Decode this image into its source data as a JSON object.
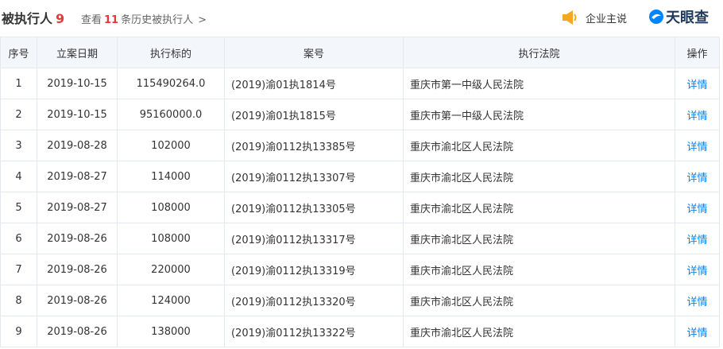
{
  "header": {
    "title": "被执行人",
    "count": "9",
    "history_prefix": "查看",
    "history_count": "11",
    "history_suffix": "条历史被执行人",
    "history_arrow": ">",
    "owner_label": "企业主说",
    "owner_icon": "speaker-icon",
    "brand": "天眼查",
    "brand_icon": "tianyancha-logo-icon",
    "accent_color": "#e4393c",
    "link_color": "#0084ff"
  },
  "table": {
    "columns": [
      "序号",
      "立案日期",
      "执行标的",
      "案号",
      "执行法院",
      "操作"
    ],
    "rows": [
      {
        "no": "1",
        "date": "2019-10-15",
        "amount": "115490264.0",
        "case": "(2019)渝01执1814号",
        "court": "重庆市第一中级人民法院",
        "action": "详情"
      },
      {
        "no": "2",
        "date": "2019-10-15",
        "amount": "95160000.0",
        "case": "(2019)渝01执1815号",
        "court": "重庆市第一中级人民法院",
        "action": "详情"
      },
      {
        "no": "3",
        "date": "2019-08-28",
        "amount": "102000",
        "case": "(2019)渝0112执13385号",
        "court": "重庆市渝北区人民法院",
        "action": "详情"
      },
      {
        "no": "4",
        "date": "2019-08-27",
        "amount": "114000",
        "case": "(2019)渝0112执13307号",
        "court": "重庆市渝北区人民法院",
        "action": "详情"
      },
      {
        "no": "5",
        "date": "2019-08-27",
        "amount": "108000",
        "case": "(2019)渝0112执13305号",
        "court": "重庆市渝北区人民法院",
        "action": "详情"
      },
      {
        "no": "6",
        "date": "2019-08-26",
        "amount": "108000",
        "case": "(2019)渝0112执13317号",
        "court": "重庆市渝北区人民法院",
        "action": "详情"
      },
      {
        "no": "7",
        "date": "2019-08-26",
        "amount": "220000",
        "case": "(2019)渝0112执13319号",
        "court": "重庆市渝北区人民法院",
        "action": "详情"
      },
      {
        "no": "8",
        "date": "2019-08-26",
        "amount": "124000",
        "case": "(2019)渝0112执13320号",
        "court": "重庆市渝北区人民法院",
        "action": "详情"
      },
      {
        "no": "9",
        "date": "2019-08-26",
        "amount": "138000",
        "case": "(2019)渝0112执13322号",
        "court": "重庆市渝北区人民法院",
        "action": "详情"
      }
    ]
  }
}
